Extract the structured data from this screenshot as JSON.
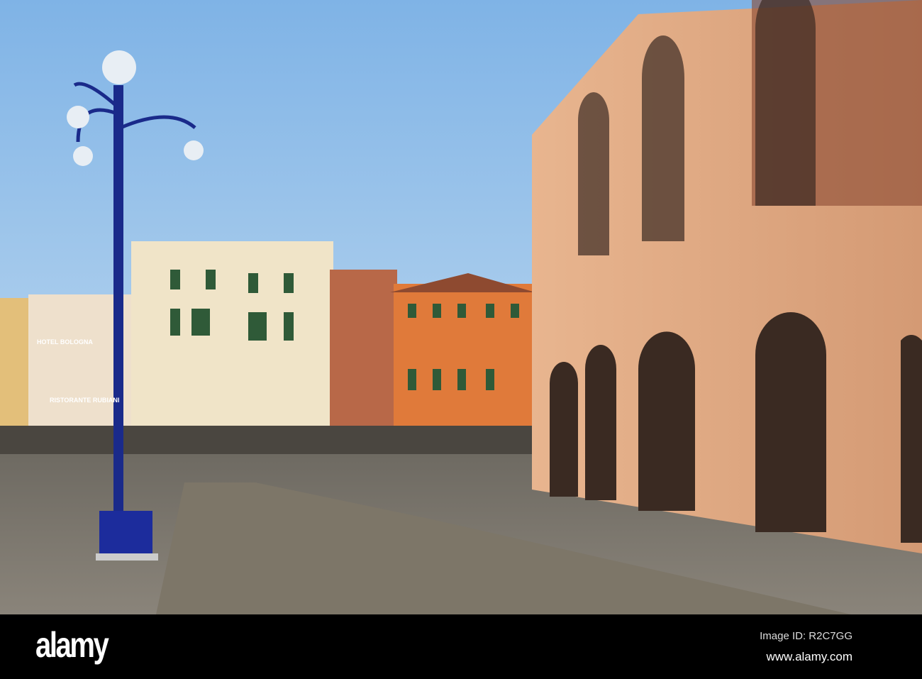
{
  "scene": {
    "signs": {
      "hotel": "HOTEL BOLOGNA",
      "restaurant": "RISTORANTE RUBIANI"
    }
  },
  "watermark": {
    "logo": "alamy",
    "image_id": "Image ID: R2C7GG",
    "url": "www.alamy.com"
  }
}
